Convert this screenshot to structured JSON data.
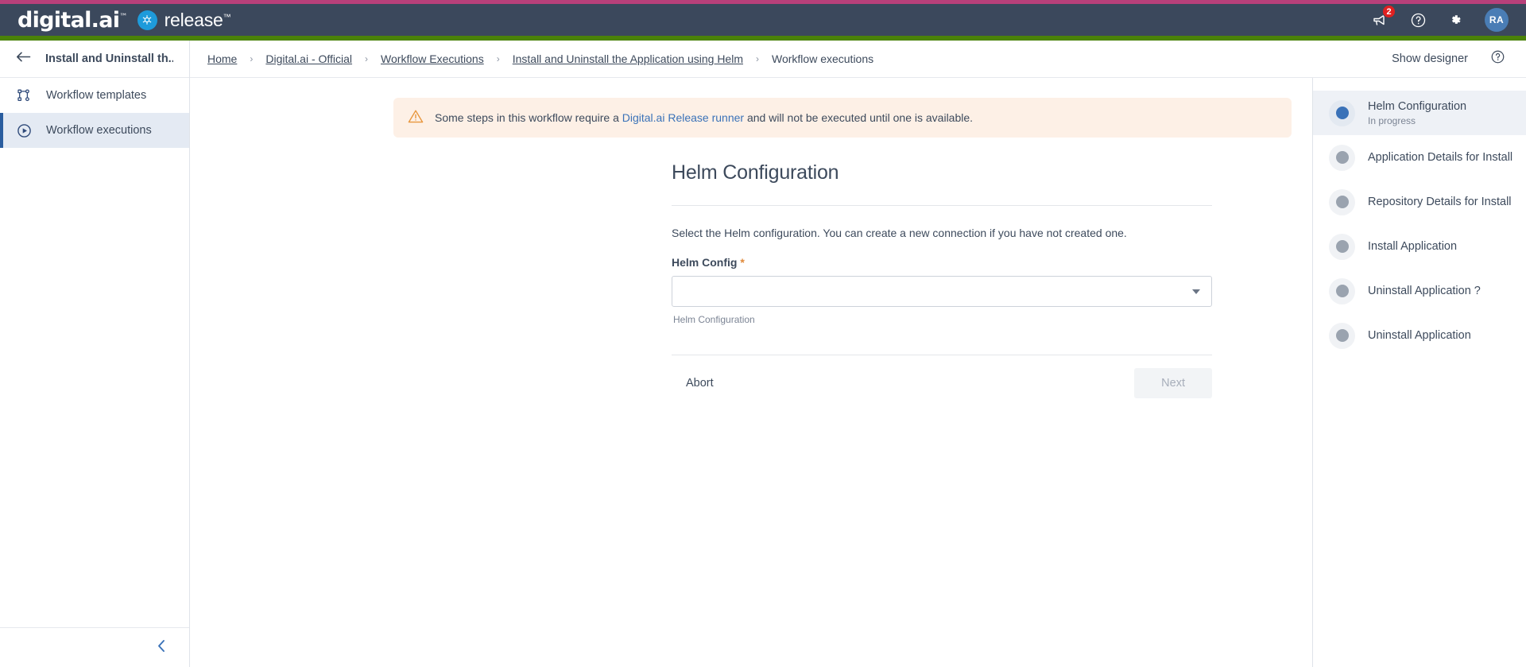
{
  "header": {
    "brand_word": "digital.ai",
    "brand_tm": "™",
    "release_word": "release",
    "release_tm": "™",
    "notifications_icon": "megaphone-icon",
    "notifications_count": "2",
    "help_icon": "help-circle-icon",
    "settings_icon": "gear-icon",
    "avatar_initials": "RA",
    "bar_color": "#3b485c",
    "accent_top_color": "#b8407a",
    "accent_green_color": "#4a8209",
    "badge_color": "#e02020",
    "avatar_color": "#4a7db5"
  },
  "sidebar": {
    "back_icon": "arrow-left-icon",
    "title": "Install and Uninstall th...",
    "items": [
      {
        "label": "Workflow templates",
        "icon": "workflow-nodes-icon",
        "active": false
      },
      {
        "label": "Workflow executions",
        "icon": "play-circle-icon",
        "active": true
      }
    ],
    "collapse_icon": "chevron-left-icon"
  },
  "breadcrumb": {
    "separator": "›",
    "items": [
      {
        "label": "Home",
        "link": true
      },
      {
        "label": "Digital.ai - Official",
        "link": true
      },
      {
        "label": "Workflow Executions",
        "link": true
      },
      {
        "label": "Install and Uninstall the Application using Helm",
        "link": true
      },
      {
        "label": "Workflow executions",
        "link": false
      }
    ],
    "show_designer_label": "Show designer",
    "help_icon": "help-circle-icon"
  },
  "banner": {
    "icon": "warning-triangle-icon",
    "text_before": "Some steps in this workflow require a ",
    "link_text": "Digital.ai Release runner",
    "text_after": " and will not be executed until one is available.",
    "bg_color": "#fdf0e6",
    "icon_color": "#e8963c"
  },
  "form": {
    "title": "Helm Configuration",
    "description": "Select the Helm configuration. You can create a new connection if you have not created one.",
    "field_label": "Helm Config",
    "required_marker": "*",
    "select_value": "",
    "select_placeholder": "",
    "caret_icon": "chevron-down-icon",
    "helper_text": "Helm Configuration",
    "abort_label": "Abort",
    "next_label": "Next"
  },
  "steps": {
    "items": [
      {
        "label": "Helm Configuration",
        "status": "In progress",
        "active": true
      },
      {
        "label": "Application Details for Install",
        "status": "",
        "active": false
      },
      {
        "label": "Repository Details for Install",
        "status": "",
        "active": false
      },
      {
        "label": "Install Application",
        "status": "",
        "active": false
      },
      {
        "label": "Uninstall Application ?",
        "status": "",
        "active": false
      },
      {
        "label": "Uninstall Application",
        "status": "",
        "active": false
      }
    ],
    "active_color": "#3a72b8",
    "inactive_color": "#9aa3af"
  }
}
